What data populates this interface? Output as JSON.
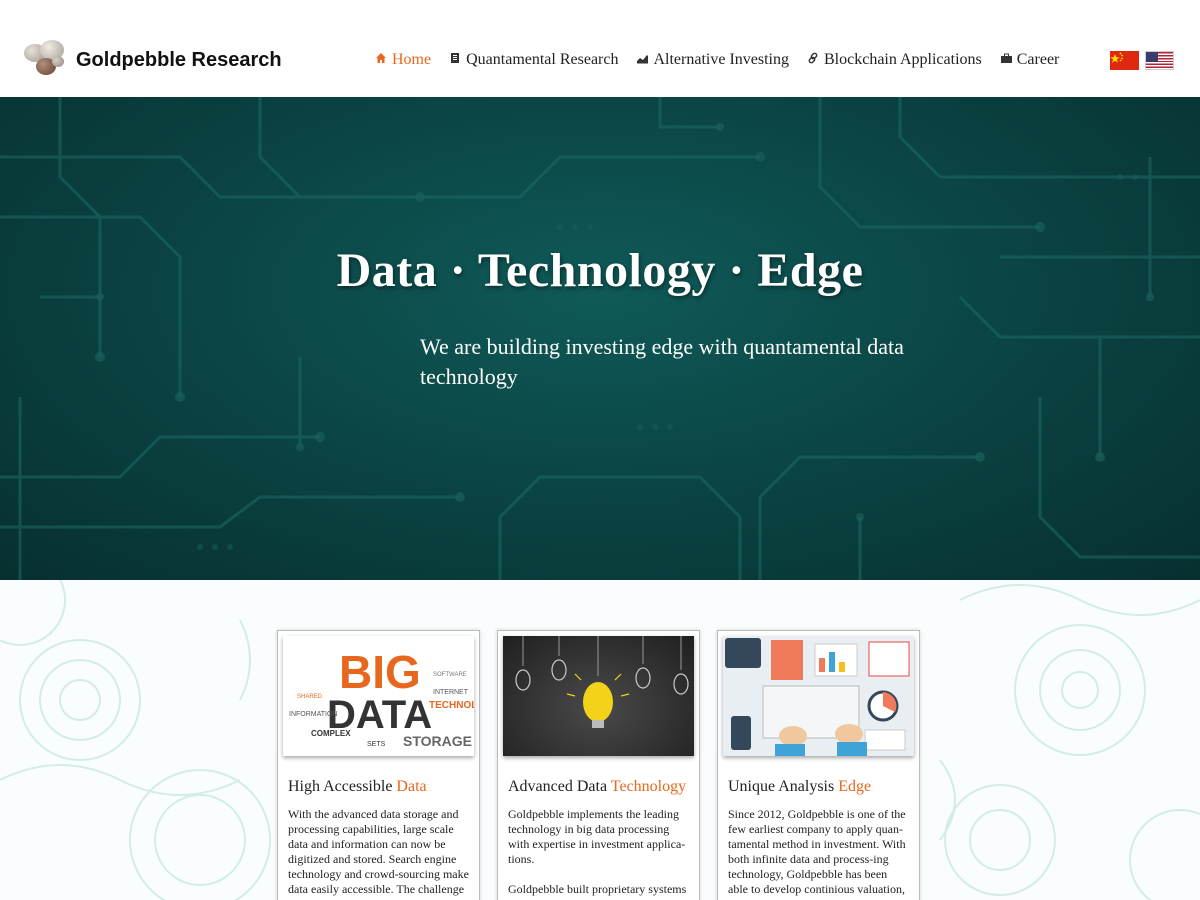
{
  "brand": {
    "name": "Goldpebble Research"
  },
  "nav": {
    "items": [
      {
        "label": "Home",
        "icon": "home-icon",
        "active": true
      },
      {
        "label": "Quantamental Research",
        "icon": "document-icon"
      },
      {
        "label": "Alternative Investing",
        "icon": "chart-icon"
      },
      {
        "label": "Blockchain Applications",
        "icon": "link-icon"
      },
      {
        "label": "Career",
        "icon": "briefcase-icon"
      }
    ],
    "flags": [
      "china-flag-icon",
      "us-flag-icon"
    ]
  },
  "hero": {
    "title": "Data · Technology · Edge",
    "subtitle": "We are building investing edge with quantamental data technology"
  },
  "cards": [
    {
      "title_prefix": "High Accessible ",
      "title_highlight": "Data",
      "paragraphs": [
        "With the advanced data storage and processing capabilities, large scale data and information can now be digitized and stored. Search engine technology and crowd-sourcing make data easily accessible.  The challenge in this new era is how to"
      ]
    },
    {
      "title_prefix": "Advanced Data ",
      "title_highlight": "Technology",
      "paragraphs": [
        "Goldpebble implements the leading technology in big data processing with expertise in investment applica-tions.",
        "Goldpebble built proprietary systems including GP-INDEX, GP-CODE, GP-"
      ]
    },
    {
      "title_prefix": "Unique Analysis ",
      "title_highlight": "Edge",
      "paragraphs": [
        "Since 2012, Goldpebble is one of the few earliest company to apply quan-tamental method in investment. With both infinite data and process-ing technology,  Goldpebble has been able to develop continious valuation, scoring, screening and"
      ]
    }
  ],
  "colors": {
    "accent": "#e8671e",
    "hero_bg": "#0b4645"
  }
}
